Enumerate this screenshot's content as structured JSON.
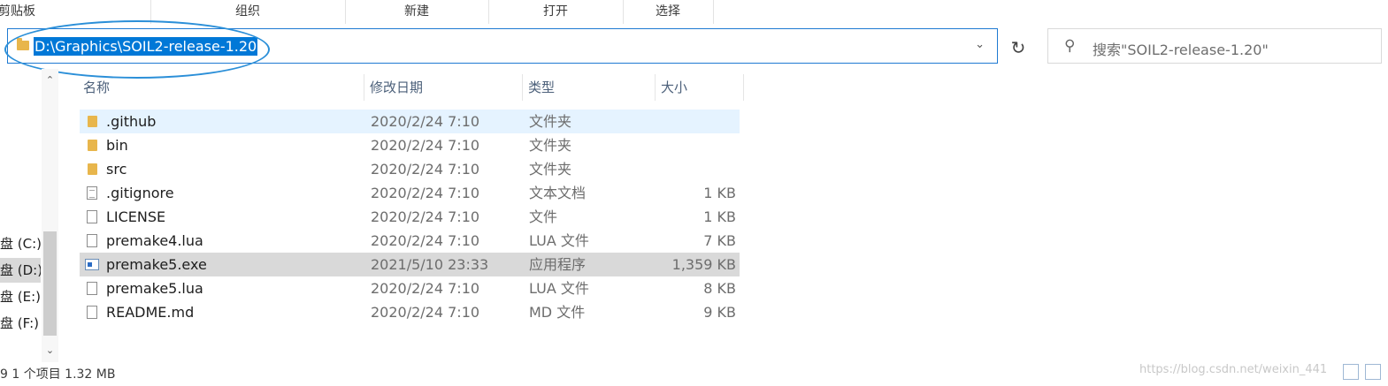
{
  "ribbon": {
    "groups": [
      "剪贴板",
      "组织",
      "新建",
      "打开",
      "选择"
    ]
  },
  "address": {
    "path": "D:\\Graphics\\SOIL2-release-1.20"
  },
  "search": {
    "placeholder": "搜索\"SOIL2-release-1.20\""
  },
  "nav": {
    "drives": [
      "盘 (C:)",
      "盘 (D:)",
      "盘 (E:)",
      "盘 (F:)"
    ],
    "selected_drive": "D:"
  },
  "columns": {
    "name": "名称",
    "date": "修改日期",
    "type": "类型",
    "size": "大小"
  },
  "files": [
    {
      "name": ".github",
      "date": "2020/2/24 7:10",
      "type": "文件夹",
      "size": "",
      "icon": "folder-icon"
    },
    {
      "name": "bin",
      "date": "2020/2/24 7:10",
      "type": "文件夹",
      "size": "",
      "icon": "folder-icon"
    },
    {
      "name": "src",
      "date": "2020/2/24 7:10",
      "type": "文件夹",
      "size": "",
      "icon": "folder-icon"
    },
    {
      "name": ".gitignore",
      "date": "2020/2/24 7:10",
      "type": "文本文档",
      "size": "1 KB",
      "icon": "text-file-icon"
    },
    {
      "name": "LICENSE",
      "date": "2020/2/24 7:10",
      "type": "文件",
      "size": "1 KB",
      "icon": "file-icon"
    },
    {
      "name": "premake4.lua",
      "date": "2020/2/24 7:10",
      "type": "LUA 文件",
      "size": "7 KB",
      "icon": "file-icon"
    },
    {
      "name": "premake5.exe",
      "date": "2021/5/10 23:33",
      "type": "应用程序",
      "size": "1,359 KB",
      "icon": "exe-icon"
    },
    {
      "name": "premake5.lua",
      "date": "2020/2/24 7:10",
      "type": "LUA 文件",
      "size": "8 KB",
      "icon": "file-icon"
    },
    {
      "name": "README.md",
      "date": "2020/2/24 7:10",
      "type": "MD 文件",
      "size": "9 KB",
      "icon": "file-icon"
    }
  ],
  "status": {
    "text": "9 1 个项目  1.32 MB"
  },
  "watermark": "https://blog.csdn.net/weixin_441",
  "colors": {
    "accent": "#0078d7",
    "selection": "#d9d9d9",
    "hover": "#e5f3ff",
    "folder": "#e8b64c"
  }
}
